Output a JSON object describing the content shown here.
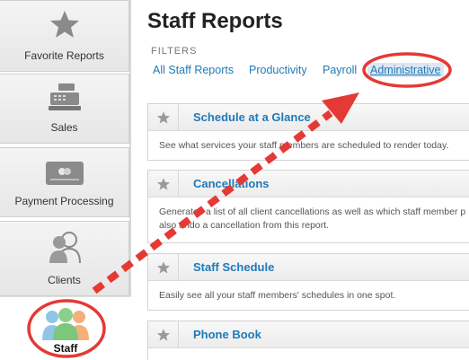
{
  "sidebar": {
    "items": [
      {
        "label": "Favorite Reports",
        "icon": "star-icon"
      },
      {
        "label": "Sales",
        "icon": "cash-register-icon"
      },
      {
        "label": "Payment Processing",
        "icon": "credit-card-icon"
      },
      {
        "label": "Clients",
        "icon": "clients-icon"
      },
      {
        "label": "Staff",
        "icon": "staff-icon"
      }
    ]
  },
  "main": {
    "title": "Staff Reports",
    "filters_label": "FILTERS",
    "tabs": [
      {
        "label": "All Staff Reports"
      },
      {
        "label": "Productivity"
      },
      {
        "label": "Payroll"
      },
      {
        "label": "Administrative"
      }
    ],
    "reports": [
      {
        "title": "Schedule at a Glance",
        "desc": "See what services your staff members are scheduled to render today."
      },
      {
        "title": "Cancellations",
        "desc": "Generates a list of all client cancellations as well as which staff member p",
        "desc2": "also undo a cancellation from this report."
      },
      {
        "title": "Staff Schedule",
        "desc": "Easily see all your staff members' schedules in one spot."
      },
      {
        "title": "Phone Book",
        "desc": ""
      }
    ]
  },
  "colors": {
    "link": "#1f7ab8",
    "annotation": "#e53935"
  }
}
